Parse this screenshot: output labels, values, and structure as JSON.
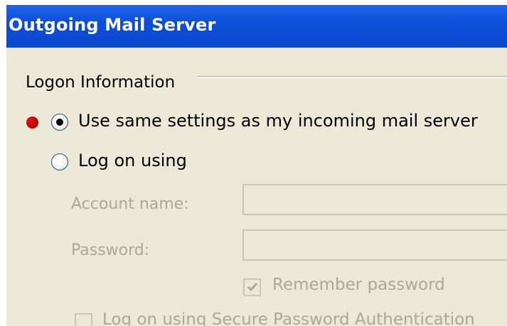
{
  "window": {
    "title": "Outgoing Mail Server"
  },
  "logon_group": {
    "label": "Logon Information",
    "options": {
      "same_settings": {
        "label": "Use same settings as my incoming mail server",
        "selected": true
      },
      "log_on_using": {
        "label": "Log on using",
        "selected": false
      }
    },
    "account_name": {
      "label": "Account name:",
      "value": "",
      "enabled": false
    },
    "password": {
      "label": "Password:",
      "value": "",
      "enabled": false
    },
    "remember_password": {
      "label": "Remember password",
      "checked": true,
      "enabled": false
    },
    "secure_password_auth": {
      "label": "Log on using Secure Password Authentication",
      "checked": false,
      "enabled": false
    }
  },
  "annotation": {
    "marker_color": "#c00000",
    "marker_icon": "red-dot-marker"
  },
  "colors": {
    "titlebar": "#0a47cc",
    "dialog_bg": "#ece9d8",
    "disabled_text": "#aca899"
  }
}
